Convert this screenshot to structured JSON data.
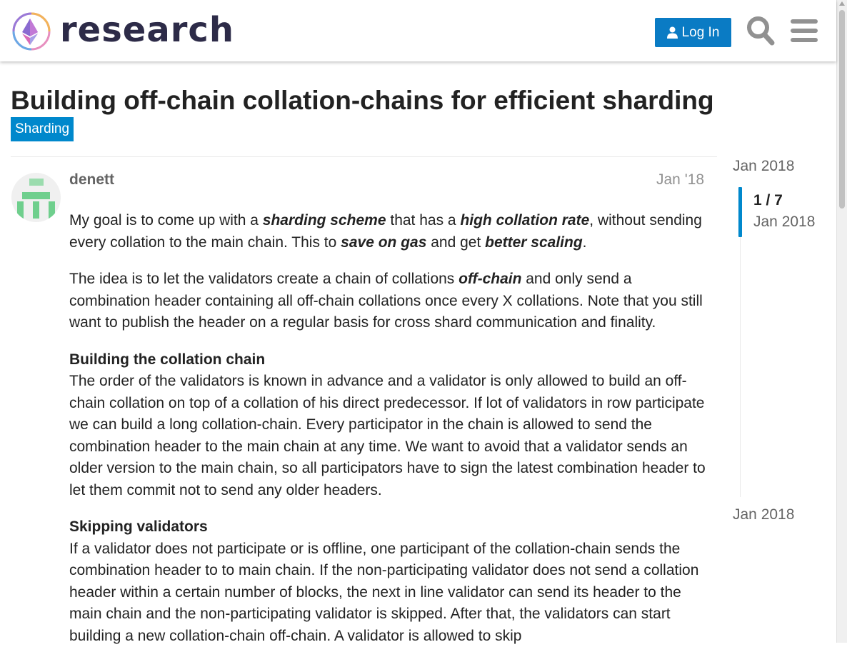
{
  "header": {
    "logo_text": "research",
    "login_label": "Log In",
    "colors": {
      "login_bg": "#0a7bc4",
      "logo_text": "#2d2b48",
      "icon": "#919191"
    }
  },
  "topic": {
    "title": "Building off-chain collation-chains for efficient sharding",
    "category": "Sharding",
    "category_color": "#0088cc"
  },
  "post": {
    "username": "denett",
    "date": "Jan '18",
    "p1": {
      "a": "My goal is to come up with a ",
      "b": "sharding scheme",
      "c": " that has a ",
      "d": "high collation rate",
      "e": ", without sending every collation to the main chain. This to ",
      "f": "save on gas",
      "g": " and get ",
      "h": "better scaling",
      "i": "."
    },
    "p2": {
      "a": "The idea is to let the validators create a chain of collations ",
      "b": "off-chain",
      "c": " and only send a combination header containing all off-chain collations once every X collations. Note that you still want to publish the header on a regular basis for cross shard communication and finality."
    },
    "section1": {
      "heading": "Building the collation chain",
      "text": "The order of the validators is known in advance and a validator is only allowed to build an off-chain collation on top of a collation of his direct predecessor. If lot of validators in row participate we can build a long collation-chain. Every participator in the chain is allowed to send the combination header to the main chain at any time. We want to avoid that a validator sends an older version to the main chain, so all participators have to sign the latest combination header to let them commit not to send any older headers."
    },
    "section2": {
      "heading": "Skipping validators",
      "text": "If a validator does not participate or is offline, one participant of the collation-chain sends the combination header to to main chain. If the non-participating validator does not send a collation header within a certain number of blocks, the next in line validator can send its header to the main chain and the non-participating validator is skipped. After that, the validators can start building a new collation-chain off-chain. A validator is allowed to skip"
    }
  },
  "timeline": {
    "start_date": "Jan 2018",
    "position": "1 / 7",
    "current_date": "Jan 2018",
    "end_date": "Jan 2018"
  }
}
